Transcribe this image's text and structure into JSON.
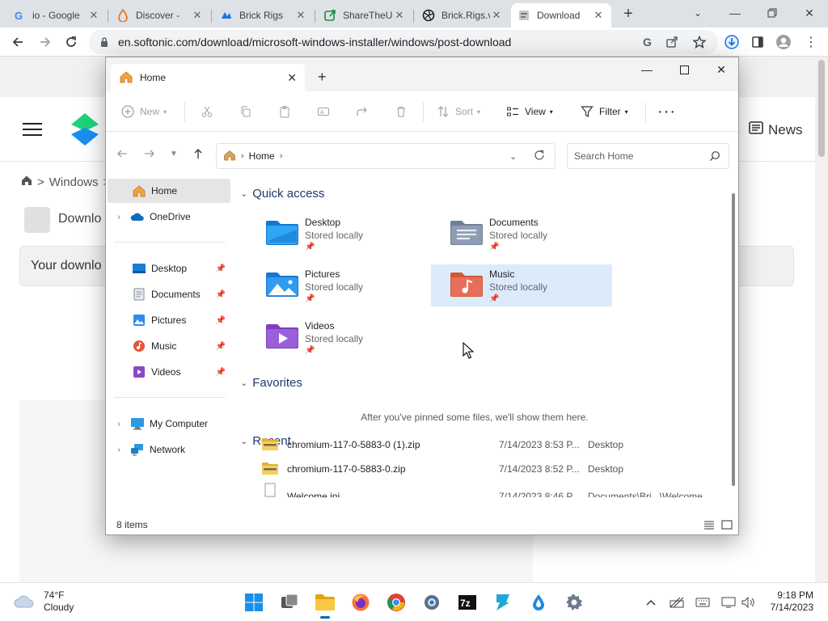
{
  "browser": {
    "tabs": [
      {
        "title": "io - Google",
        "icon": "google-icon",
        "active": false
      },
      {
        "title": "Discover -",
        "icon": "droplet-icon",
        "active": false
      },
      {
        "title": "Brick Rigs",
        "icon": "brick-rigs-icon",
        "active": false
      },
      {
        "title": "ShareTheU",
        "icon": "share-icon",
        "active": false
      },
      {
        "title": "Brick.Rigs.v",
        "icon": "aperture-icon",
        "active": false
      },
      {
        "title": "Download",
        "icon": "softonic-icon",
        "active": true
      }
    ],
    "url": "en.softonic.com/download/microsoft-windows-installer/windows/post-download"
  },
  "page": {
    "breadcrumb": [
      "Windows",
      ">"
    ],
    "news_label": "News",
    "download_title": "Downlo",
    "download_box_text": "Your downlo"
  },
  "explorer": {
    "tab_title": "Home",
    "commands": {
      "new": "New",
      "sort": "Sort",
      "view": "View",
      "filter": "Filter"
    },
    "address": {
      "crumb": "Home"
    },
    "search_placeholder": "Search Home",
    "nav": {
      "home": "Home",
      "onedrive": "OneDrive",
      "pinned": [
        {
          "label": "Desktop",
          "icon": "desktop-icon"
        },
        {
          "label": "Documents",
          "icon": "documents-icon"
        },
        {
          "label": "Pictures",
          "icon": "pictures-icon"
        },
        {
          "label": "Music",
          "icon": "music-icon"
        },
        {
          "label": "Videos",
          "icon": "videos-icon"
        }
      ],
      "my_computer": "My Computer",
      "network": "Network"
    },
    "quick_access": {
      "heading": "Quick access",
      "items": [
        {
          "name": "Desktop",
          "status": "Stored locally"
        },
        {
          "name": "Documents",
          "status": "Stored locally"
        },
        {
          "name": "Pictures",
          "status": "Stored locally"
        },
        {
          "name": "Music",
          "status": "Stored locally"
        },
        {
          "name": "Videos",
          "status": "Stored locally"
        }
      ]
    },
    "favorites": {
      "heading": "Favorites",
      "empty_text": "After you've pinned some files, we'll show them here."
    },
    "recent": {
      "heading": "Recent",
      "rows": [
        {
          "name": "chromium-117-0-5883-0 (1).zip",
          "date": "7/14/2023 8:53 P...",
          "location": "Desktop"
        },
        {
          "name": "chromium-117-0-5883-0.zip",
          "date": "7/14/2023 8:52 P...",
          "location": "Desktop"
        },
        {
          "name": "Welcome.ini",
          "date": "7/14/2023 8:46 P...",
          "location": "Documents\\Bri...\\Welcome"
        }
      ]
    },
    "status": "8 items"
  },
  "taskbar": {
    "weather_temp": "74°F",
    "weather_desc": "Cloudy",
    "time": "9:18 PM",
    "date": "7/14/2023"
  },
  "colors": {
    "accent": "#0067c0",
    "selection": "#dcebfb",
    "chrome_tabstrip": "#dee1e6"
  }
}
